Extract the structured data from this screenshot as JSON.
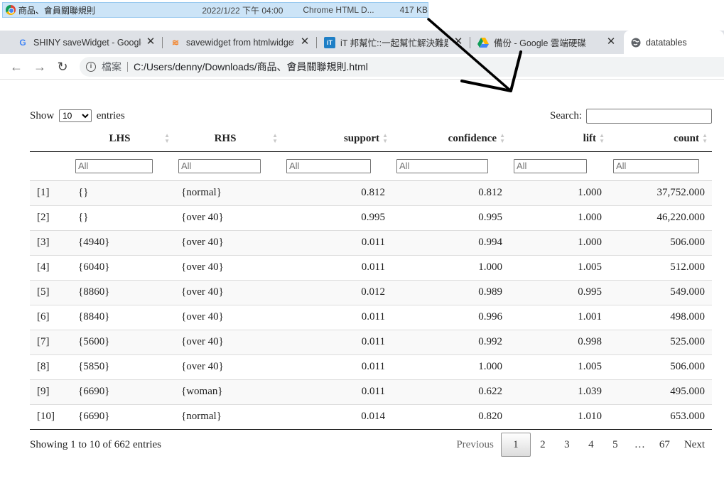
{
  "file_strip": {
    "name": "商品、會員關聯規則",
    "date": "2022/1/22 下午 04:00",
    "type": "Chrome HTML D...",
    "size": "417 KB"
  },
  "tabs": [
    {
      "icon": "google-icon",
      "label": "SHINY saveWidget - Google"
    },
    {
      "icon": "stackoverflow-icon",
      "label": "savewidget from htmlwidgets"
    },
    {
      "icon": "ithome-icon",
      "label": "iT 邦幫忙::一起幫忙解決難題"
    },
    {
      "icon": "google-drive-icon",
      "label": "備份 - Google 雲端硬碟"
    },
    {
      "icon": "globe-icon",
      "label": "datatables"
    }
  ],
  "address": {
    "protocol": "檔案",
    "url": "C:/Users/denny/Downloads/商品、會員關聯規則.html"
  },
  "datatable": {
    "length_prefix": "Show",
    "length_value": "10",
    "length_suffix": "entries",
    "search_label": "Search:",
    "search_value": "",
    "filter_placeholder": "All",
    "columns": [
      "LHS",
      "RHS",
      "support",
      "confidence",
      "lift",
      "count"
    ],
    "rows": [
      [
        "[1]",
        "{}",
        "{normal}",
        "0.812",
        "0.812",
        "1.000",
        "37,752.000"
      ],
      [
        "[2]",
        "{}",
        "{over 40}",
        "0.995",
        "0.995",
        "1.000",
        "46,220.000"
      ],
      [
        "[3]",
        "{4940}",
        "{over 40}",
        "0.011",
        "0.994",
        "1.000",
        "506.000"
      ],
      [
        "[4]",
        "{6040}",
        "{over 40}",
        "0.011",
        "1.000",
        "1.005",
        "512.000"
      ],
      [
        "[5]",
        "{8860}",
        "{over 40}",
        "0.012",
        "0.989",
        "0.995",
        "549.000"
      ],
      [
        "[6]",
        "{8840}",
        "{over 40}",
        "0.011",
        "0.996",
        "1.001",
        "498.000"
      ],
      [
        "[7]",
        "{5600}",
        "{over 40}",
        "0.011",
        "0.992",
        "0.998",
        "525.000"
      ],
      [
        "[8]",
        "{5850}",
        "{over 40}",
        "0.011",
        "1.000",
        "1.005",
        "506.000"
      ],
      [
        "[9]",
        "{6690}",
        "{woman}",
        "0.011",
        "0.622",
        "1.039",
        "495.000"
      ],
      [
        "[10]",
        "{6690}",
        "{normal}",
        "0.014",
        "0.820",
        "1.010",
        "653.000"
      ]
    ],
    "info": "Showing 1 to 10 of 662 entries",
    "paging": {
      "previous": "Previous",
      "pages": [
        "1",
        "2",
        "3",
        "4",
        "5"
      ],
      "ellipsis": "…",
      "last": "67",
      "next": "Next",
      "current": "1"
    }
  }
}
